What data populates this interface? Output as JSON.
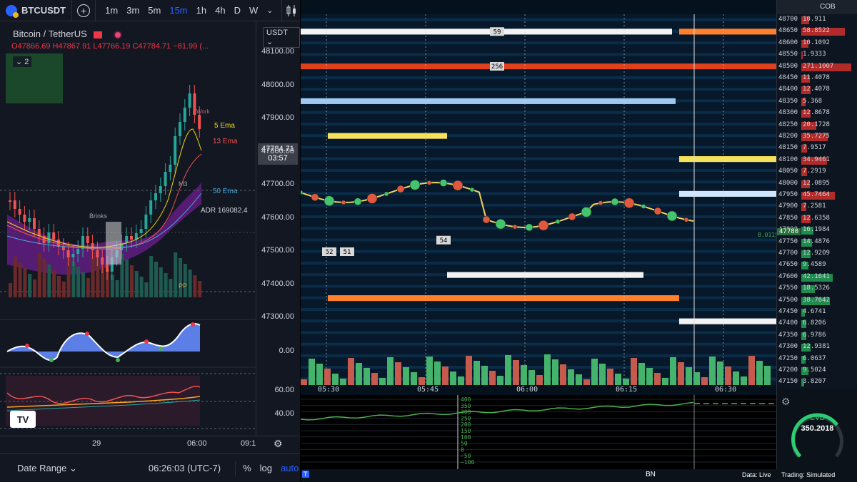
{
  "toolbar": {
    "symbol": "BTCUSDT",
    "timeframes": [
      "1m",
      "3m",
      "5m",
      "15m",
      "1h",
      "4h",
      "D",
      "W"
    ],
    "active_timeframe": "15m"
  },
  "chart": {
    "title": "Bitcoin / TetherUS",
    "ohlc": {
      "open": "O47866.69",
      "high": "H47867.91",
      "low": "L47766.19",
      "close": "C47784.71",
      "change": "−81.99 (..."
    },
    "collapsed_count": "2",
    "currency": "USDT",
    "price_ticks": [
      "48100.00",
      "48000.00",
      "47900.00",
      "47800.00",
      "47700.00",
      "47600.00",
      "47500.00",
      "47400.00",
      "47300.00"
    ],
    "last_price": "47784.71",
    "countdown": "03:57",
    "labels": {
      "ema5": "5 Ema",
      "ema13": "13 Ema",
      "ema50": "50 Ema",
      "adr": "ADR 169082.4",
      "m3": "M3",
      "pp": "PP",
      "work": "Work",
      "brinks": "Brinks"
    },
    "osc1_tick": "0.00",
    "osc2_ticks": [
      "60.00",
      "40.00"
    ],
    "time_ticks": [
      "29",
      "06:00",
      "09:1"
    ],
    "logo": "TV"
  },
  "bottom_bar": {
    "date_range": "Date Range",
    "clock": "06:26:03 (UTC-7)",
    "percent": "%",
    "log": "log",
    "auto": "auto"
  },
  "heatmap": {
    "ladder_title": "COB",
    "ladder": [
      {
        "price": "48700",
        "size": "10.911"
      },
      {
        "price": "48650",
        "size": "58.8522"
      },
      {
        "price": "48600",
        "size": "10.1092"
      },
      {
        "price": "48550",
        "size": "1.9333"
      },
      {
        "price": "48500",
        "size": "271.1007"
      },
      {
        "price": "48450",
        "size": "11.4078"
      },
      {
        "price": "48400",
        "size": "12.4078"
      },
      {
        "price": "48350",
        "size": "5.368"
      },
      {
        "price": "48300",
        "size": "12.8678"
      },
      {
        "price": "48250",
        "size": "20.1728"
      },
      {
        "price": "48200",
        "size": "35.7275"
      },
      {
        "price": "48150",
        "size": "7.9517"
      },
      {
        "price": "48100",
        "size": "34.9461"
      },
      {
        "price": "48050",
        "size": "7.2919"
      },
      {
        "price": "48000",
        "size": "12.0895"
      },
      {
        "price": "47950",
        "size": "45.7464"
      },
      {
        "price": "47900",
        "size": "7.2581"
      },
      {
        "price": "47850",
        "size": "12.6358"
      },
      {
        "price": "47800",
        "size": "16.1984"
      },
      {
        "price": "47750",
        "size": "14.4876"
      },
      {
        "price": "47700",
        "size": "12.9209"
      },
      {
        "price": "47650",
        "size": "9.4589"
      },
      {
        "price": "47600",
        "size": "42.1641"
      },
      {
        "price": "47550",
        "size": "18.5326"
      },
      {
        "price": "47500",
        "size": "38.7642"
      },
      {
        "price": "47450",
        "size": "4.6741"
      },
      {
        "price": "47400",
        "size": "6.8206"
      },
      {
        "price": "47350",
        "size": "6.9786"
      },
      {
        "price": "47300",
        "size": "12.9381"
      },
      {
        "price": "47250",
        "size": "6.0637"
      },
      {
        "price": "47200",
        "size": "9.5024"
      },
      {
        "price": "47150",
        "size": "3.8207"
      }
    ],
    "current_price_tag": "47780",
    "current_price_marker": "8.0115",
    "level_labels": [
      "59",
      "256",
      "52",
      "51",
      "54"
    ],
    "time_ticks": [
      "05:30",
      "05:45",
      "06:00",
      "06:15",
      "06:30"
    ],
    "cvd_ticks": [
      "400",
      "350",
      "300",
      "250",
      "200",
      "150",
      "100",
      "50",
      "0",
      "−50",
      "−100"
    ],
    "cvd_title": "CVD",
    "cvd_value": "350.2018",
    "cvd_fraction": 0.7,
    "status": {
      "left_mark": "T",
      "exchange": "BN",
      "data": "Data: Live",
      "trading": "Trading: Simulated"
    }
  },
  "colors": {
    "bg": "#131722",
    "up": "#26a69a",
    "down": "#ef5350",
    "accent": "#2962ff",
    "ema5": "#f5d90a",
    "ema13": "#ef5350",
    "ema50": "#4aa8d8",
    "cvd_line": "#4caf50"
  }
}
